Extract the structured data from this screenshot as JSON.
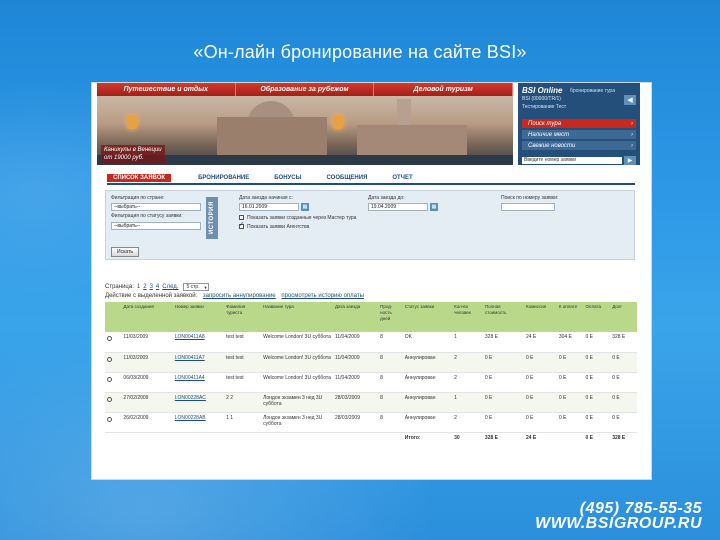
{
  "slide": {
    "title": "«Он-лайн бронирование на сайте BSI»",
    "footer_phone": "(495) 785-55-35",
    "footer_url": "WWW.BSIGROUP.RU"
  },
  "topnav": [
    "Путешествие и отдых",
    "Образование за рубежом",
    "Деловой туризм"
  ],
  "banner": {
    "caption": "Каникулы в Венеции\nот 19000 руб."
  },
  "bsi_panel": {
    "title": "BSI Online",
    "subtitle": "бронирование тура",
    "code": "BSI (00000/TR/1)",
    "user": "Тестирование Тест",
    "back_icon": "arrow-left-icon",
    "menu": [
      {
        "label": "Поиск тура",
        "active": true
      },
      {
        "label": "Наличие мест",
        "active": false
      },
      {
        "label": "Свежие новости",
        "active": false
      }
    ],
    "search_placeholder": "Введите номер заявки",
    "search_icon": "arrow-right-icon"
  },
  "tabs": [
    "СПИСОК ЗАЯВОК",
    "БРОНИРОВАНИЕ",
    "БОНУСЫ",
    "СООБЩЕНИЯ",
    "ОТЧЕТ"
  ],
  "filter": {
    "country_label": "Фильтрация по стране:",
    "country_value": "--выбрать--",
    "status_label": "Фильтрация по статусу заявки:",
    "status_value": "--выбрать--",
    "stamp": "ИСТОРИЯ",
    "date_from_label": "Дата заезда начиная с:",
    "date_from_value": "16.01.2009",
    "date_to_label": "Дата заезда до:",
    "date_to_value": "19.04.2009",
    "opt1_label": "Показать заявки созданные через Мастер тура",
    "opt2_label": "Показать заявки Агентства",
    "order_search_label": "Поиск по номеру заявки:",
    "order_search_value": "",
    "apply_label": "Искать"
  },
  "pagination": {
    "label": "Страница:",
    "pages": [
      "1",
      "2",
      "3",
      "4"
    ],
    "next_label": "След.",
    "per_page": "5 стр."
  },
  "actions": {
    "label": "Действие с выделенной заявкой:",
    "link1": "запросить аннулирование",
    "link2": "просмотреть историю оплаты"
  },
  "table": {
    "headers": [
      "",
      "Дата создания",
      "Номер заявки",
      "Фамилия туриста",
      "Название тура",
      "Дата заезда",
      "Прод-ность дней",
      "Статус заявки",
      "Кол-во человек",
      "Полная стоимость",
      "Комиссия",
      "К оплате",
      "Оплата",
      "Долг"
    ],
    "rows": [
      [
        "",
        "11/03/2009",
        "LON00411A8",
        "test test",
        "Welcome London! 3U суббота",
        "11/04/2009",
        "8",
        "OK",
        "1",
        "328 Е",
        "24 Е",
        "304 Е",
        "0 Е",
        "328 Е"
      ],
      [
        "",
        "11/03/2009",
        "LON00411A7",
        "test test",
        "Welcome London! 3U суббота",
        "11/04/2009",
        "8",
        "Аннулирован",
        "2",
        "0 Е",
        "0 Е",
        "0 Е",
        "0 Е",
        "0 Е"
      ],
      [
        "",
        "06/03/2009",
        "LON00411A4",
        "test test",
        "Welcome London! 3U суббота",
        "11/04/2009",
        "8",
        "Аннулирован",
        "2",
        "0 Е",
        "0 Е",
        "0 Е",
        "0 Е",
        "0 Е"
      ],
      [
        "",
        "27/02/2009",
        "LON00228AC",
        "2 2",
        "Лондон экзамен 3 нед 3U суббота",
        "28/03/2009",
        "8",
        "Аннулирован",
        "1",
        "0 Е",
        "0 Е",
        "0 Е",
        "0 Е",
        "0 Е"
      ],
      [
        "",
        "26/02/2009",
        "LON00228AB",
        "1 1",
        "Лондон экзамен 3 нед 3U суббота",
        "28/03/2009",
        "8",
        "Аннулирован",
        "2",
        "0 Е",
        "0 Е",
        "0 Е",
        "0 Е",
        "0 Е"
      ]
    ],
    "total": [
      "",
      "",
      "",
      "",
      "",
      "",
      "",
      "Итого:",
      "30",
      "328 Е",
      "24 Е",
      "",
      "0 Е",
      "328 Е"
    ]
  }
}
